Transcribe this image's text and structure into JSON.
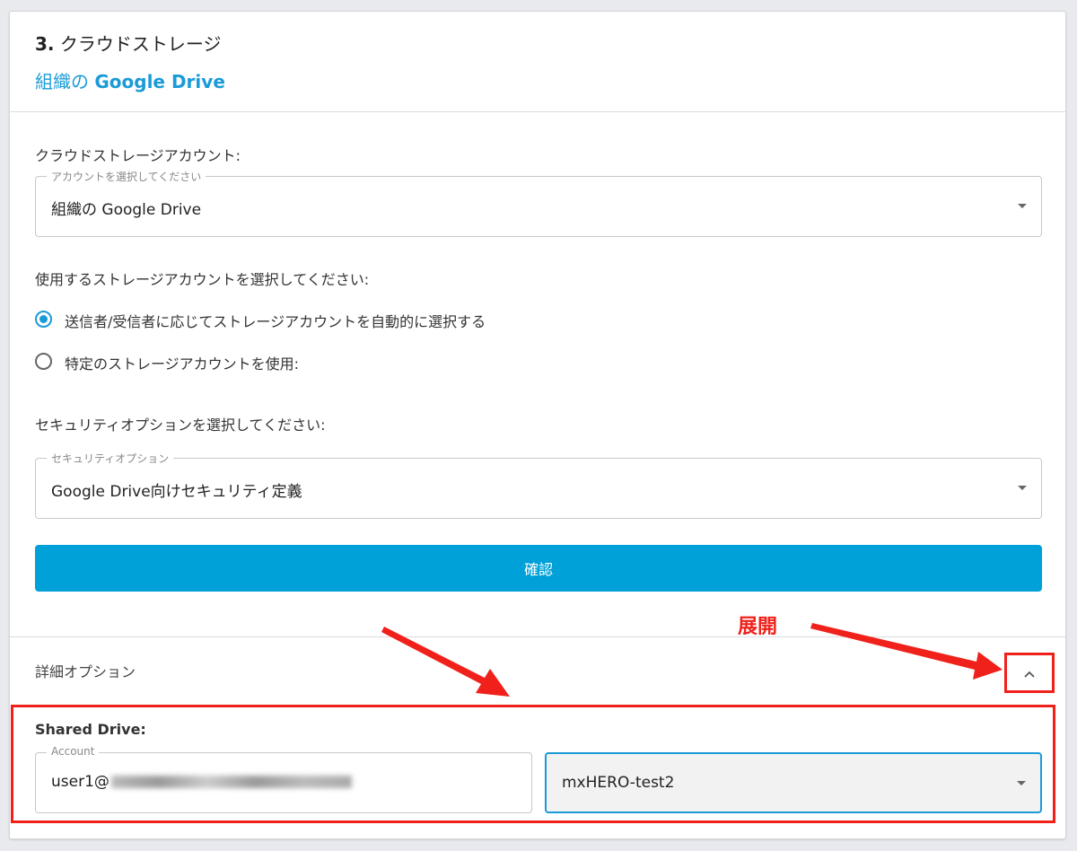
{
  "header": {
    "step_number": "3.",
    "title": "クラウドストレージ",
    "subtitle_prefix": "組織の",
    "subtitle_brand": "Google Drive"
  },
  "storage_account": {
    "label": "クラウドストレージアカウント:",
    "legend": "アカウントを選択してください",
    "value": "組織の Google Drive"
  },
  "account_choice": {
    "label": "使用するストレージアカウントを選択してください:",
    "options": [
      {
        "label": "送信者/受信者に応じてストレージアカウントを自動的に選択する",
        "selected": true
      },
      {
        "label": "特定のストレージアカウントを使用:",
        "selected": false
      }
    ]
  },
  "security": {
    "label": "セキュリティオプションを選択してください:",
    "legend": "セキュリティオプション",
    "value": "Google Drive向けセキュリティ定義"
  },
  "confirm_label": "確認",
  "advanced": {
    "title": "詳細オプション",
    "shared_drive_label": "Shared Drive:",
    "account_legend": "Account",
    "account_value": "user1@",
    "drive_value": "mxHERO-test2"
  },
  "annotation": {
    "expand_label": "展開"
  },
  "colors": {
    "accent": "#00a0d8",
    "annotation": "#f0211b"
  }
}
